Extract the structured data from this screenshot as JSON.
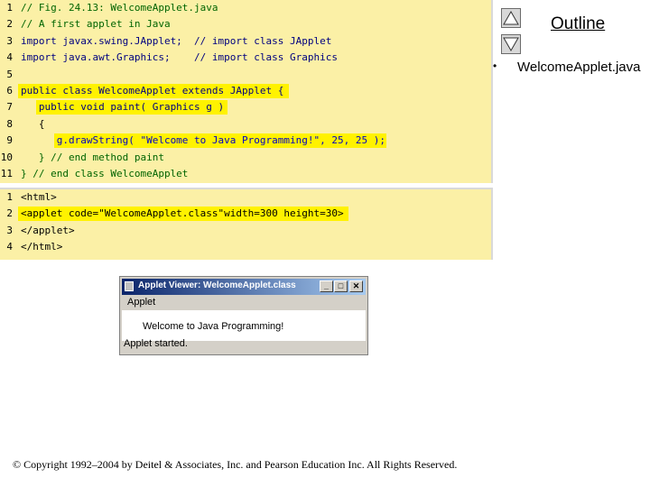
{
  "java_source": {
    "lines": [
      {
        "num": "1",
        "text": "// Fig. 24.13: WelcomeApplet.java"
      },
      {
        "num": "2",
        "text": "// A first applet in Java"
      },
      {
        "num": "3",
        "text": "import javax.swing.JApplet;  // import class JApplet"
      },
      {
        "num": "4",
        "text": "import java.awt.Graphics;    // import class Graphics"
      },
      {
        "num": "5",
        "text": ""
      },
      {
        "num": "6",
        "text": "public class WelcomeApplet extends JApplet {"
      },
      {
        "num": "7",
        "text": "   public void paint( Graphics g )"
      },
      {
        "num": "8",
        "text": "   {"
      },
      {
        "num": "9",
        "text": "      g.drawString( \"Welcome to Java Programming!\", 25, 25 );"
      },
      {
        "num": "10",
        "text": "   } // end method paint"
      },
      {
        "num": "11",
        "text": "} // end class WelcomeApplet"
      }
    ]
  },
  "html_source": {
    "lines": [
      {
        "num": "1",
        "text": "<html>"
      },
      {
        "num": "2",
        "text": "<applet code=\"WelcomeApplet.class\"width=300 height=30>"
      },
      {
        "num": "3",
        "text": "</applet>"
      },
      {
        "num": "4",
        "text": "</html>"
      }
    ]
  },
  "outline": {
    "title": "Outline",
    "bullet": "•",
    "item": "WelcomeApplet.java"
  },
  "applet_viewer": {
    "title": "Applet Viewer: WelcomeApplet.class",
    "minimize_label": "_",
    "maximize_label": "□",
    "close_label": "✕",
    "menu_label": "Applet",
    "message": "Welcome to Java Programming!",
    "status": "Applet started."
  },
  "footer": {
    "copyright": "© Copyright 1992–2004 by Deitel & Associates, Inc. and Pearson Education Inc. All Rights Reserved."
  },
  "colors": {
    "code_background": "#fbf0a6",
    "highlight": "#fff200",
    "titlebar": "#0a246a"
  },
  "icons": {
    "up": "triangle-up-icon",
    "down": "triangle-down-icon",
    "app": "java-cup-icon"
  }
}
